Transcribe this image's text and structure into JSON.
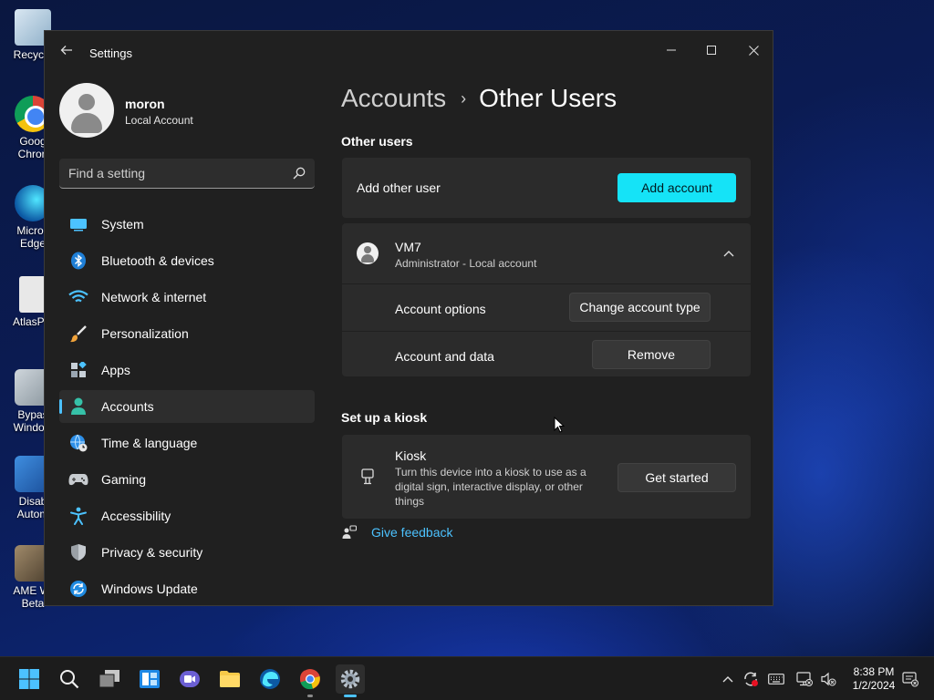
{
  "desktop": {
    "icons": [
      {
        "label": "Recycle",
        "icon": "recycle-bin-icon"
      },
      {
        "label": "Goog Chron",
        "icon": "chrome-icon"
      },
      {
        "label": "Micros Edge",
        "icon": "edge-icon"
      },
      {
        "label": "AtlasPla",
        "icon": "document-icon"
      },
      {
        "label": "Bypas Window",
        "icon": "gear-shortcut-icon"
      },
      {
        "label": "Disab Autom",
        "icon": "cubes-icon"
      },
      {
        "label": "AME Wi Beta",
        "icon": "app-icon"
      }
    ]
  },
  "window": {
    "title": "Settings",
    "accent_color": "#15e3f7"
  },
  "profile": {
    "name": "moron",
    "type": "Local Account"
  },
  "search": {
    "placeholder": "Find a setting"
  },
  "nav": {
    "items": [
      {
        "label": "System",
        "icon": "display-icon"
      },
      {
        "label": "Bluetooth & devices",
        "icon": "bluetooth-icon"
      },
      {
        "label": "Network & internet",
        "icon": "wifi-icon"
      },
      {
        "label": "Personalization",
        "icon": "brush-icon"
      },
      {
        "label": "Apps",
        "icon": "apps-icon"
      },
      {
        "label": "Accounts",
        "icon": "person-icon",
        "active": true
      },
      {
        "label": "Time & language",
        "icon": "globe-clock-icon"
      },
      {
        "label": "Gaming",
        "icon": "gamepad-icon"
      },
      {
        "label": "Accessibility",
        "icon": "accessibility-icon"
      },
      {
        "label": "Privacy & security",
        "icon": "shield-icon"
      },
      {
        "label": "Windows Update",
        "icon": "update-icon"
      }
    ]
  },
  "breadcrumb": {
    "parent": "Accounts",
    "separator": "›",
    "current": "Other Users"
  },
  "other_users": {
    "section_title": "Other users",
    "add_label": "Add other user",
    "add_button": "Add account",
    "user": {
      "name": "VM7",
      "detail": "Administrator - Local account",
      "options_label": "Account options",
      "options_button": "Change account type",
      "data_label": "Account and data",
      "data_button": "Remove"
    }
  },
  "kiosk": {
    "section_title": "Set up a kiosk",
    "title": "Kiosk",
    "description": "Turn this device into a kiosk to use as a digital sign, interactive display, or other things",
    "button": "Get started"
  },
  "feedback": {
    "label": "Give feedback"
  },
  "taskbar": {
    "time": "8:38 PM",
    "date": "1/2/2024"
  }
}
